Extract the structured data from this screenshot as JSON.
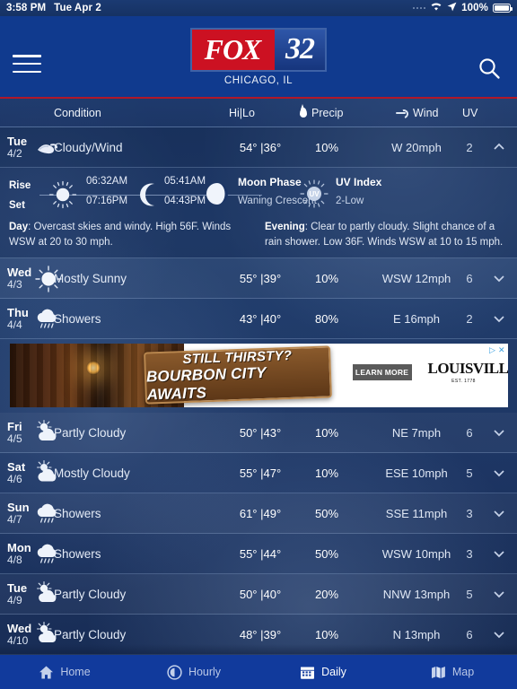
{
  "status_bar": {
    "time": "3:58 PM",
    "date": "Tue Apr 2",
    "battery_pct": "100%",
    "icons": [
      "signal-dots-icon",
      "wifi-icon",
      "location-arrow-icon",
      "battery-icon"
    ]
  },
  "header": {
    "menu_icon": "hamburger-menu-icon",
    "search_icon": "search-icon",
    "logo_fox": "FOX",
    "logo_channel": "32",
    "city": "CHICAGO, IL",
    "accent_red": "#b0172a",
    "brand_blue": "#103a8e"
  },
  "columns": {
    "condition": "Condition",
    "hilo": "Hi|Lo",
    "precip": "Precip",
    "wind": "Wind",
    "uv": "UV"
  },
  "forecast": [
    {
      "day": "Tue",
      "date": "4/2",
      "icon": "cloudy-wind-icon",
      "condition": "Cloudy/Wind",
      "hilo": "54° |36°",
      "precip": "10%",
      "wind": "W 20mph",
      "uv": "2",
      "chevron": "chevron-up-icon",
      "expanded": true,
      "detail": {
        "rise_label": "Rise",
        "set_label": "Set",
        "sunrise": "06:32AM",
        "sunset": "07:16PM",
        "moonrise": "05:41AM",
        "moonset": "04:43PM",
        "moon_phase_label": "Moon Phase",
        "moon_phase_value": "Waning Crescent",
        "uv_index_label": "UV Index",
        "uv_index_value": "2-Low",
        "day_label": "Day",
        "day_text": ": Overcast skies and windy. High 56F. Winds WSW at 20 to 30 mph.",
        "evening_label": "Evening",
        "evening_text": ": Clear to partly cloudy. Slight chance of a rain shower. Low 36F. Winds WSW at 10 to 15 mph."
      }
    },
    {
      "day": "Wed",
      "date": "4/3",
      "icon": "mostly-sunny-icon",
      "condition": "Mostly Sunny",
      "hilo": "55° |39°",
      "precip": "10%",
      "wind": "WSW 12mph",
      "uv": "6",
      "chevron": "chevron-down-icon",
      "expanded": false
    },
    {
      "day": "Thu",
      "date": "4/4",
      "icon": "showers-icon",
      "condition": "Showers",
      "hilo": "43° |40°",
      "precip": "80%",
      "wind": "E 16mph",
      "uv": "2",
      "chevron": "chevron-down-icon",
      "expanded": false
    },
    {
      "day": "Fri",
      "date": "4/5",
      "icon": "partly-cloudy-icon",
      "condition": "Partly Cloudy",
      "hilo": "50° |43°",
      "precip": "10%",
      "wind": "NE 7mph",
      "uv": "6",
      "chevron": "chevron-down-icon",
      "expanded": false
    },
    {
      "day": "Sat",
      "date": "4/6",
      "icon": "mostly-cloudy-icon",
      "condition": "Mostly Cloudy",
      "hilo": "55° |47°",
      "precip": "10%",
      "wind": "ESE 10mph",
      "uv": "5",
      "chevron": "chevron-down-icon",
      "expanded": false
    },
    {
      "day": "Sun",
      "date": "4/7",
      "icon": "showers-icon",
      "condition": "Showers",
      "hilo": "61° |49°",
      "precip": "50%",
      "wind": "SSE 11mph",
      "uv": "3",
      "chevron": "chevron-down-icon",
      "expanded": false
    },
    {
      "day": "Mon",
      "date": "4/8",
      "icon": "showers-icon",
      "condition": "Showers",
      "hilo": "55° |44°",
      "precip": "50%",
      "wind": "WSW 10mph",
      "uv": "3",
      "chevron": "chevron-down-icon",
      "expanded": false
    },
    {
      "day": "Tue",
      "date": "4/9",
      "icon": "partly-cloudy-icon",
      "condition": "Partly Cloudy",
      "hilo": "50° |40°",
      "precip": "20%",
      "wind": "NNW 13mph",
      "uv": "5",
      "chevron": "chevron-down-icon",
      "expanded": false
    },
    {
      "day": "Wed",
      "date": "4/10",
      "icon": "partly-cloudy-icon",
      "condition": "Partly Cloudy",
      "hilo": "48° |39°",
      "precip": "10%",
      "wind": "N 13mph",
      "uv": "6",
      "chevron": "chevron-down-icon",
      "expanded": false
    }
  ],
  "ad": {
    "line1": "STILL THIRSTY?",
    "line2": "BOURBON CITY AWAITS",
    "cta": "LEARN MORE",
    "brand": "LOUISVILLE",
    "brand_sub": "EST. 1778",
    "close_icon": "ad-close-icon",
    "info_icon": "ad-choices-icon"
  },
  "tabbar": {
    "items": [
      {
        "label": "Home",
        "icon": "home-icon",
        "active": false
      },
      {
        "label": "Hourly",
        "icon": "clock-icon",
        "active": false
      },
      {
        "label": "Daily",
        "icon": "calendar-icon",
        "active": true
      },
      {
        "label": "Map",
        "icon": "map-icon",
        "active": false
      }
    ]
  }
}
